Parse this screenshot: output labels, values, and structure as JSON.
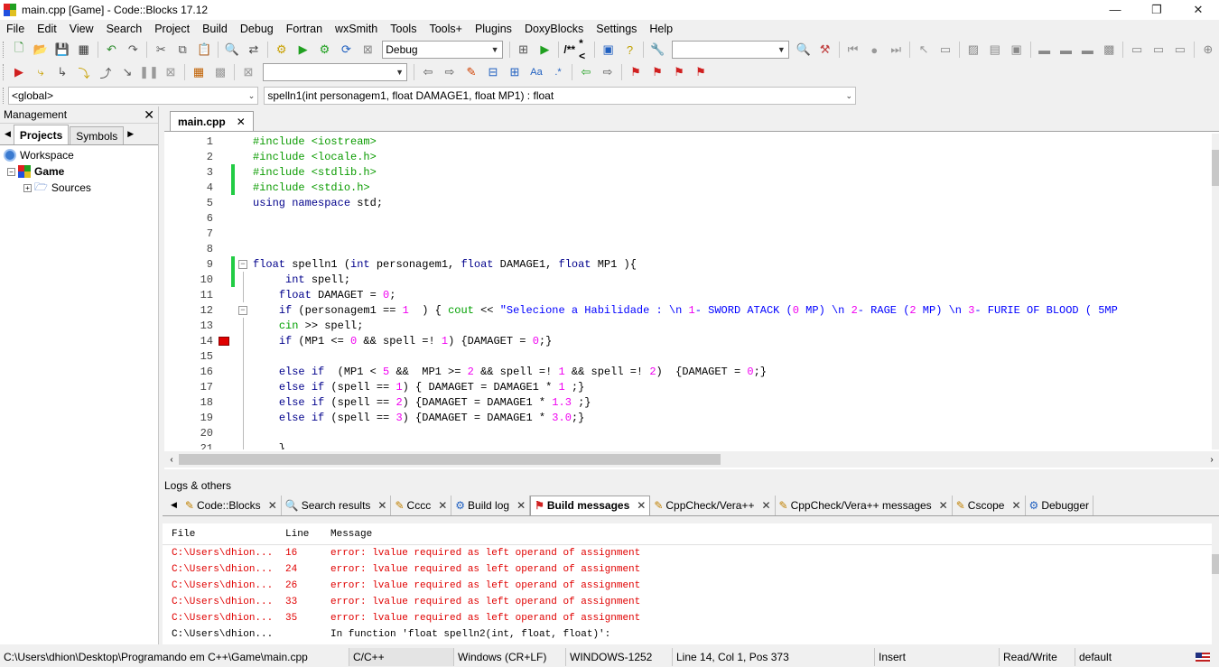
{
  "window": {
    "title": "main.cpp [Game] - Code::Blocks 17.12",
    "controls": [
      "—",
      "❐",
      "✕"
    ]
  },
  "menu": [
    "File",
    "Edit",
    "View",
    "Search",
    "Project",
    "Build",
    "Debug",
    "Fortran",
    "wxSmith",
    "Tools",
    "Tools+",
    "Plugins",
    "DoxyBlocks",
    "Settings",
    "Help"
  ],
  "toolbar": {
    "build_target": "Debug",
    "search_value": "",
    "comment_labels": [
      "/**",
      "*<"
    ]
  },
  "scope": {
    "global": "<global>",
    "function": "spelln1(int personagem1, float DAMAGE1, float MP1) : float"
  },
  "management": {
    "title": "Management",
    "tabs": [
      "Projects",
      "Symbols"
    ],
    "tree": {
      "workspace": "Workspace",
      "project": "Game",
      "folder": "Sources"
    }
  },
  "editor": {
    "tab": "main.cpp",
    "lines": [
      {
        "n": "1",
        "t": "#include <iostream>"
      },
      {
        "n": "2",
        "t": "#include <locale.h>"
      },
      {
        "n": "3",
        "t": "#include <stdlib.h>"
      },
      {
        "n": "4",
        "t": "#include <stdio.h>"
      },
      {
        "n": "5",
        "t": "using namespace std;"
      },
      {
        "n": "6",
        "t": ""
      },
      {
        "n": "7",
        "t": ""
      },
      {
        "n": "8",
        "t": ""
      },
      {
        "n": "9",
        "t": "float spelln1 (int personagem1, float DAMAGE1, float MP1 ){"
      },
      {
        "n": "10",
        "t": "     int spell;"
      },
      {
        "n": "11",
        "t": "    float DAMAGET = 0;"
      },
      {
        "n": "12",
        "t": "    if (personagem1 == 1  ) { cout << \"Selecione a Habilidade : \\n 1- SWORD ATACK (0 MP) \\n 2- RAGE (2 MP) \\n 3- FURIE OF BLOOD ( 5MP"
      },
      {
        "n": "13",
        "t": "    cin >> spell;"
      },
      {
        "n": "14",
        "t": "    if (MP1 <= 0 && spell =! 1) {DAMAGET = 0;}"
      },
      {
        "n": "15",
        "t": ""
      },
      {
        "n": "16",
        "t": "    else if  (MP1 < 5 &&  MP1 >= 2 && spell =! 1 && spell =! 2)  {DAMAGET = 0;}"
      },
      {
        "n": "17",
        "t": "    else if (spell == 1) { DAMAGET = DAMAGE1 * 1 ;}"
      },
      {
        "n": "18",
        "t": "    else if (spell == 2) {DAMAGET = DAMAGE1 * 1.3 ;}"
      },
      {
        "n": "19",
        "t": "    else if (spell == 3) {DAMAGET = DAMAGE1 * 3.0;}"
      },
      {
        "n": "20",
        "t": ""
      },
      {
        "n": "21",
        "t": "    }"
      }
    ]
  },
  "logs": {
    "title": "Logs & others",
    "tabs": [
      "Code::Blocks",
      "Search results",
      "Cccc",
      "Build log",
      "Build messages",
      "CppCheck/Vera++",
      "CppCheck/Vera++ messages",
      "Cscope",
      "Debugger"
    ],
    "columns": [
      "File",
      "Line",
      "Message"
    ],
    "rows": [
      {
        "file": "C:\\Users\\dhion...",
        "line": "16",
        "msg": "error: lvalue required as left operand of assignment",
        "error": true
      },
      {
        "file": "C:\\Users\\dhion...",
        "line": "24",
        "msg": "error: lvalue required as left operand of assignment",
        "error": true
      },
      {
        "file": "C:\\Users\\dhion...",
        "line": "26",
        "msg": "error: lvalue required as left operand of assignment",
        "error": true
      },
      {
        "file": "C:\\Users\\dhion...",
        "line": "33",
        "msg": "error: lvalue required as left operand of assignment",
        "error": true
      },
      {
        "file": "C:\\Users\\dhion...",
        "line": "35",
        "msg": "error: lvalue required as left operand of assignment",
        "error": true
      },
      {
        "file": "C:\\Users\\dhion...",
        "line": "",
        "msg": "In function 'float spelln2(int, float, float)':",
        "error": false
      }
    ]
  },
  "status": {
    "path": "C:\\Users\\dhion\\Desktop\\Programando em C++\\Game\\main.cpp",
    "lang": "C/C++",
    "eol": "Windows (CR+LF)",
    "encoding": "WINDOWS-1252",
    "position": "Line 14, Col 1, Pos 373",
    "mode": "Insert",
    "access": "Read/Write",
    "theme": "default"
  }
}
